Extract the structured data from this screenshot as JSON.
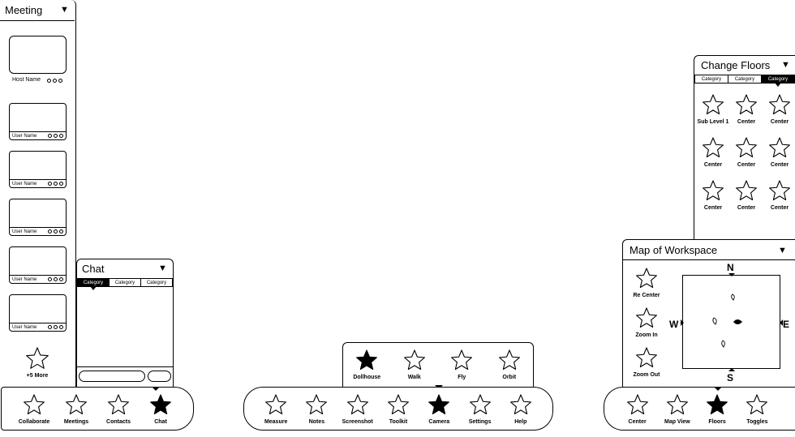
{
  "meeting": {
    "title": "Meeting",
    "host_name": "Host Name",
    "participants": [
      "User Name",
      "User Name",
      "User Name",
      "User Name",
      "User Name"
    ],
    "more_label": "+5 More"
  },
  "chat": {
    "title": "Chat",
    "tabs": [
      "Category",
      "Category",
      "Category"
    ],
    "active_tab": 0
  },
  "change_floors": {
    "title": "Change Floors",
    "tabs": [
      "Category",
      "Category",
      "Category"
    ],
    "active_tab": 2,
    "items": [
      "Sub Level 1",
      "Center",
      "Center",
      "Center",
      "Center",
      "Center",
      "Center",
      "Center",
      "Center"
    ]
  },
  "map": {
    "title": "Map of Workspace",
    "actions": [
      "Re Center",
      "Zoom In",
      "Zoom Out"
    ],
    "compass": {
      "n": "N",
      "s": "S",
      "e": "E",
      "w": "W"
    }
  },
  "camera_modes": [
    {
      "label": "Dollhouse",
      "filled": true
    },
    {
      "label": "Walk",
      "filled": false
    },
    {
      "label": "Fly",
      "filled": false
    },
    {
      "label": "Orbit",
      "filled": false
    }
  ],
  "left_toolbar": [
    {
      "label": "Collaborate",
      "filled": false
    },
    {
      "label": "Meetings",
      "filled": false
    },
    {
      "label": "Contacts",
      "filled": false
    },
    {
      "label": "Chat",
      "filled": true
    }
  ],
  "center_toolbar": [
    {
      "label": "Measure",
      "filled": false
    },
    {
      "label": "Notes",
      "filled": false
    },
    {
      "label": "Screenshot",
      "filled": false
    },
    {
      "label": "Toolkit",
      "filled": false
    },
    {
      "label": "Camera",
      "filled": true
    },
    {
      "label": "Settings",
      "filled": false
    },
    {
      "label": "Help",
      "filled": false
    }
  ],
  "right_toolbar": [
    {
      "label": "Center",
      "filled": false
    },
    {
      "label": "Map View",
      "filled": false
    },
    {
      "label": "Floors",
      "filled": true
    },
    {
      "label": "Toggles",
      "filled": false
    }
  ]
}
